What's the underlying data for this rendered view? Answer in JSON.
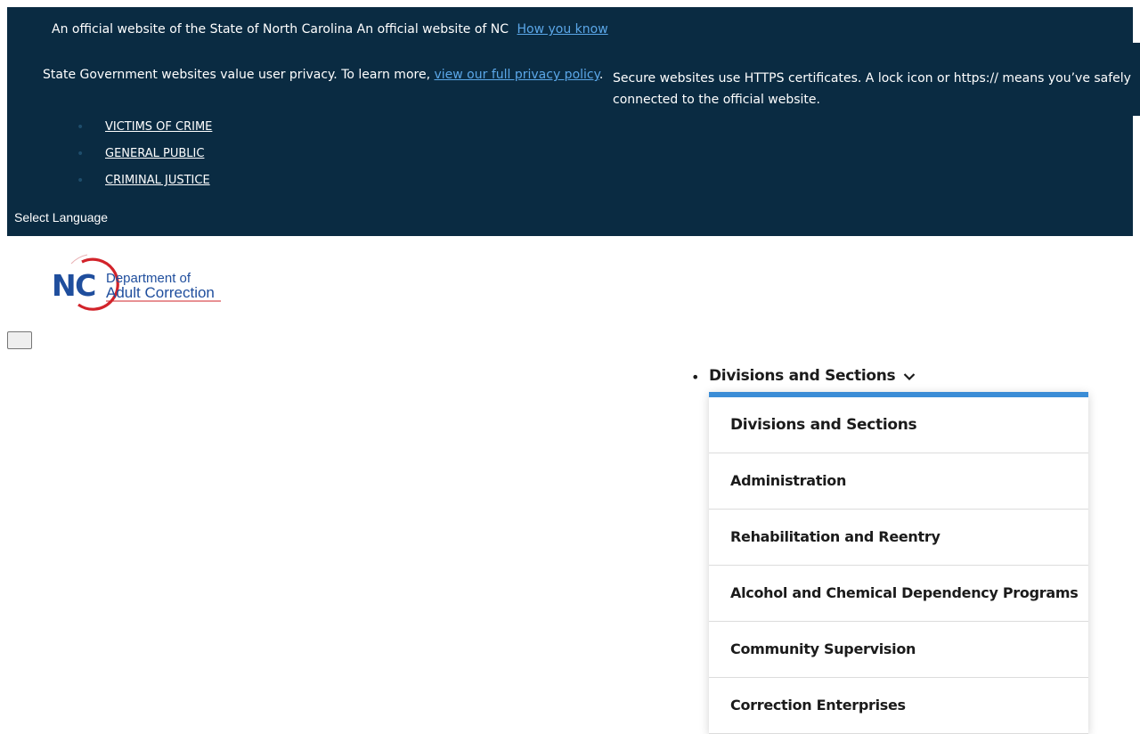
{
  "banner": {
    "official_text": "An official website of the State of North Carolina An official website of NC",
    "how_you_know": "How you know",
    "privacy_text": "State Government websites value user privacy. To learn more,",
    "privacy_link": "view our full privacy policy",
    "privacy_end": ".",
    "secure_text": "Secure websites use HTTPS certificates. A lock icon or https:// means you’ve safely connected to the official website."
  },
  "audience_links": [
    "VICTIMS OF CRIME",
    "GENERAL PUBLIC",
    "CRIMINAL JUSTICE"
  ],
  "language": {
    "label": "Select Language"
  },
  "logo": {
    "line1": "NC",
    "line2": "Department of",
    "line3": "Adult Correction"
  },
  "nav": {
    "label": "Divisions and Sections",
    "dropdown": [
      "Divisions and Sections",
      "Administration",
      "Rehabilitation and Reentry",
      "Alcohol and Chemical Dependency Programs",
      "Community Supervision",
      "Correction Enterprises"
    ]
  },
  "colors": {
    "banner_bg": "#0a2b42",
    "link": "#5ba7e8",
    "accent": "#3b8dd6",
    "logo_red": "#d2232a",
    "logo_blue": "#1f4e9d"
  }
}
